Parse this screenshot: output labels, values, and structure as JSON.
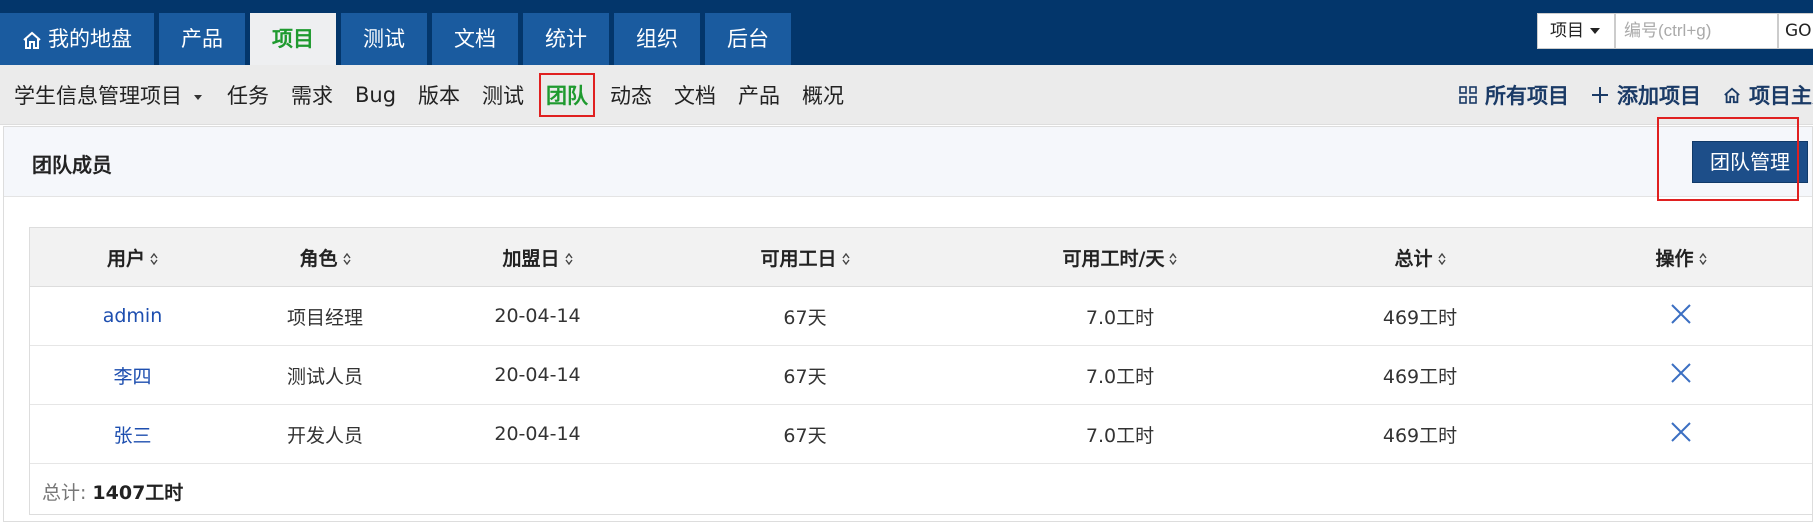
{
  "top_nav": {
    "tabs": [
      {
        "label": "我的地盘",
        "icon": "home-icon"
      },
      {
        "label": "产品"
      },
      {
        "label": "项目",
        "active": true
      },
      {
        "label": "测试"
      },
      {
        "label": "文档"
      },
      {
        "label": "统计"
      },
      {
        "label": "组织"
      },
      {
        "label": "后台"
      }
    ],
    "search": {
      "scope": "项目",
      "placeholder": "编号(ctrl+g)",
      "go": "GO"
    }
  },
  "sub_nav": {
    "project": "学生信息管理项目",
    "items": [
      "任务",
      "需求",
      "Bug",
      "版本",
      "测试",
      "团队",
      "动态",
      "文档",
      "产品",
      "概况"
    ],
    "active": "团队",
    "right": [
      {
        "label": "所有项目",
        "icon": "grid-icon"
      },
      {
        "label": "添加项目",
        "icon": "plus-icon"
      },
      {
        "label": "项目主页",
        "icon": "home-icon"
      }
    ]
  },
  "panel": {
    "title": "团队成员",
    "manage_button": "团队管理"
  },
  "table": {
    "columns": [
      "用户",
      "角色",
      "加盟日",
      "可用工日",
      "可用工时/天",
      "总计",
      "操作"
    ],
    "rows": [
      [
        "admin",
        "项目经理",
        "20-04-14",
        "67天",
        "7.0工时",
        "469工时"
      ],
      [
        "李四",
        "测试人员",
        "20-04-14",
        "67天",
        "7.0工时",
        "469工时"
      ],
      [
        "张三",
        "开发人员",
        "20-04-14",
        "67天",
        "7.0工时",
        "469工时"
      ]
    ],
    "footer_label": "总计:",
    "footer_value": "1407工时"
  },
  "colors": {
    "topbar": "#03366b",
    "tab": "#1a5b9f",
    "active_green": "#1f9a2f",
    "button": "#1d4e89",
    "highlight": "#e02020"
  }
}
